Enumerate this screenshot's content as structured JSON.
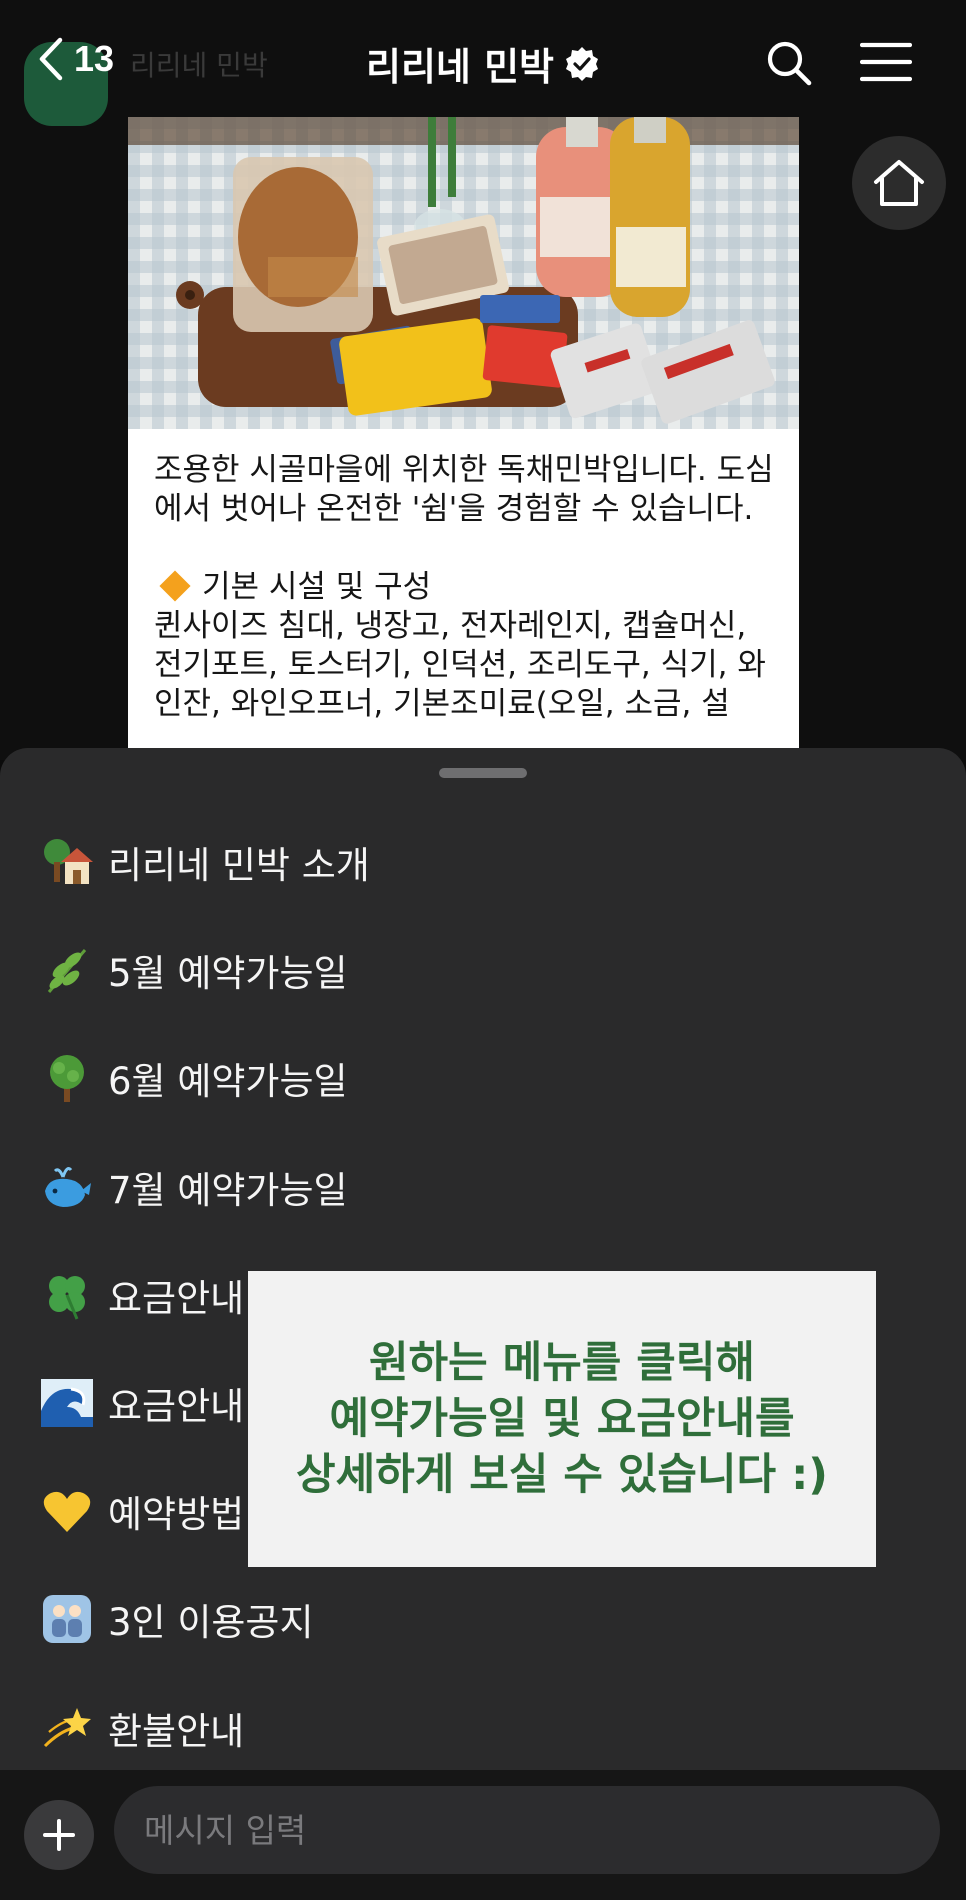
{
  "header": {
    "back_count": "13",
    "title": "리리네 민박",
    "verified_icon": "verified-badge-icon",
    "search_icon": "search-icon",
    "menu_icon": "hamburger-menu-icon",
    "home_icon": "home-icon"
  },
  "chat": {
    "sender_name_ghost": "리리네 민박",
    "message": {
      "photo": "photo of bread, snacks, coffee sachets and juice bottles on a wooden board",
      "paragraph1": "조용한 시골마을에 위치한 독채민박입니다. 도심에서 벗어나 온전한 '쉼'을 경험할 수 있습니다.",
      "section_icon": "orange-diamond-icon",
      "section_title": "기본 시설 및 구성",
      "facilities": "퀸사이즈 침대, 냉장고, 전자레인지, 캡슐머신, 전기포트, 토스터기, 인덕션, 조리도구, 식기, 와인잔, 와인오프너, 기본조미료(오일, 소금, 설"
    }
  },
  "menu": {
    "items": [
      {
        "emoji": "house-with-tree-icon",
        "label": "리리네 민박 소개"
      },
      {
        "emoji": "herb-icon",
        "label": "5월 예약가능일"
      },
      {
        "emoji": "tree-icon",
        "label": "6월 예약가능일"
      },
      {
        "emoji": "whale-icon",
        "label": "7월 예약가능일"
      },
      {
        "emoji": "four-leaf-clover-icon",
        "label": "요금안내 (3월-6월)"
      },
      {
        "emoji": "wave-icon",
        "label": "요금안내 (7월-8"
      },
      {
        "emoji": "yellow-heart-icon",
        "label": "예약방법"
      },
      {
        "emoji": "family-icon",
        "label": "3인 이용공지"
      },
      {
        "emoji": "dizzy-star-icon",
        "label": "환불안내"
      }
    ],
    "overlay_note": "원하는 메뉴를 클릭해\n예약가능일 및 요금안내를\n상세하게 보실 수 있습니다 :)"
  },
  "input": {
    "placeholder": "메시지 입력",
    "value": "",
    "plus_icon": "plus-icon"
  },
  "colors": {
    "background": "#0b0b0b",
    "sheet": "#2a2a2b",
    "note_text": "#2f6e3a",
    "note_bg": "#f2f2f2"
  }
}
